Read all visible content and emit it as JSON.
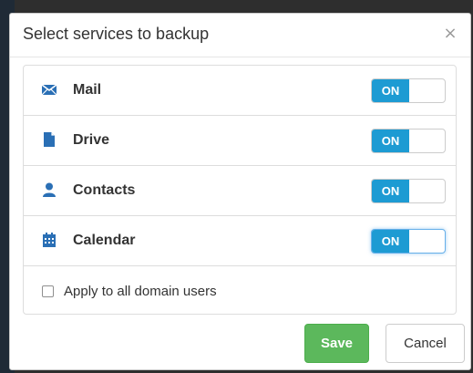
{
  "dialog": {
    "title": "Select services to backup",
    "close_glyph": "×"
  },
  "services": [
    {
      "label": "Mail",
      "icon": "mail-icon",
      "toggle_label": "ON",
      "enabled": true
    },
    {
      "label": "Drive",
      "icon": "file-icon",
      "toggle_label": "ON",
      "enabled": true
    },
    {
      "label": "Contacts",
      "icon": "user-icon",
      "toggle_label": "ON",
      "enabled": true
    },
    {
      "label": "Calendar",
      "icon": "calendar-icon",
      "toggle_label": "ON",
      "enabled": true
    }
  ],
  "apply_all": {
    "label": "Apply to all domain users",
    "checked": false
  },
  "buttons": {
    "save_label": "Save",
    "cancel_label": "Cancel"
  },
  "colors": {
    "icon": "#2a6fb5",
    "toggle_on": "#1d9bd3",
    "save": "#5cb85c"
  }
}
